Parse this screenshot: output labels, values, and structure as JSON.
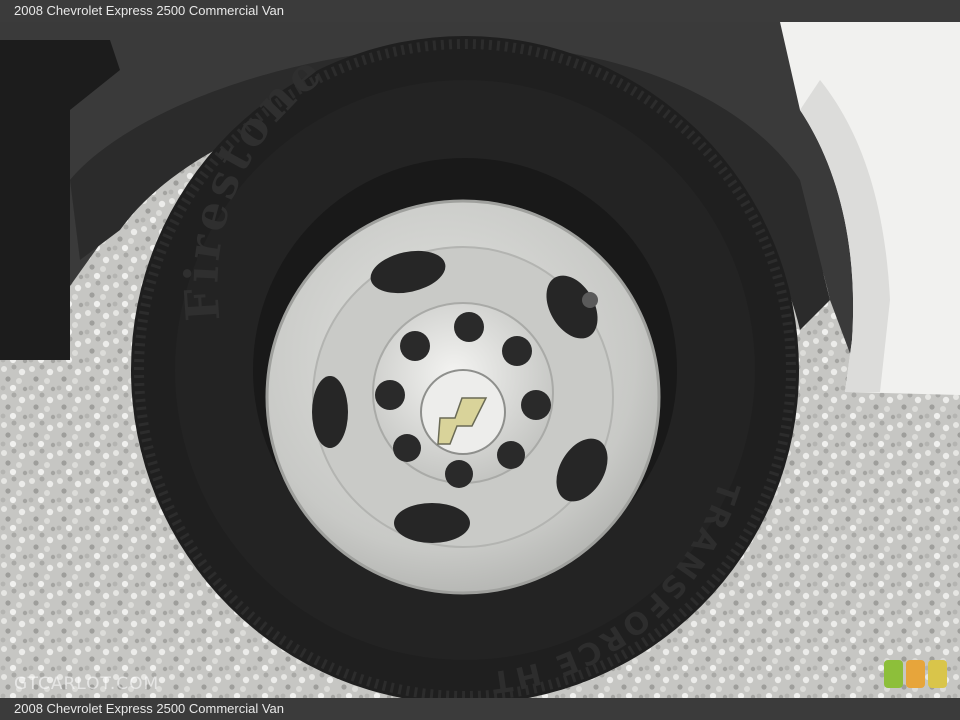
{
  "caption": {
    "top": "2008 Chevrolet Express 2500 Commercial Van",
    "bottom": "2008 Chevrolet Express 2500 Commercial Van"
  },
  "tire": {
    "brand": "Firestone",
    "model": "TRANSFORCE HT"
  },
  "watermark": "GTCARLOT.COM",
  "colors": {
    "bar": "#3b3b3b",
    "gravel": "#c9c9c6",
    "van_body": "#f2f2f0",
    "tire": "#1e1e1e",
    "wheel": "#cfd0cd",
    "logo_green": "#8dbf3a",
    "logo_orange": "#e7a53b",
    "logo_yellow": "#d9c54a"
  },
  "icons": [
    "chevrolet-bowtie-icon",
    "gtcarlot-logo-icon"
  ]
}
